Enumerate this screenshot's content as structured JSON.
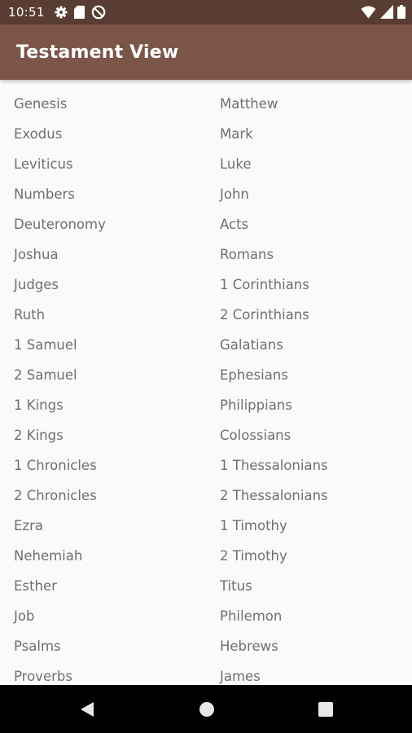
{
  "status_bar": {
    "time": "10:51",
    "left_icons": [
      "gear-icon",
      "sd-card-icon",
      "do-not-disturb-icon"
    ],
    "right_icons": [
      "wifi-icon",
      "signal-icon",
      "battery-icon"
    ]
  },
  "app_bar": {
    "title": "Testament View"
  },
  "old_testament": [
    "Genesis",
    "Exodus",
    "Leviticus",
    "Numbers",
    "Deuteronomy",
    "Joshua",
    "Judges",
    "Ruth",
    "1 Samuel",
    "2 Samuel",
    "1 Kings",
    "2 Kings",
    "1 Chronicles",
    "2 Chronicles",
    "Ezra",
    "Nehemiah",
    "Esther",
    "Job",
    "Psalms",
    "Proverbs"
  ],
  "new_testament": [
    "Matthew",
    "Mark",
    "Luke",
    "John",
    "Acts",
    "Romans",
    "1 Corinthians",
    "2 Corinthians",
    "Galatians",
    "Ephesians",
    "Philippians",
    "Colossians",
    "1 Thessalonians",
    "2 Thessalonians",
    "1 Timothy",
    "2 Timothy",
    "Titus",
    "Philemon",
    "Hebrews",
    "James"
  ],
  "nav_bar": {
    "buttons": [
      "back-icon",
      "home-icon",
      "recent-apps-icon"
    ]
  },
  "colors": {
    "status_bar": "#5a3d32",
    "app_bar": "#7a5548",
    "background": "#fafafa",
    "book_text": "#6f6f6f"
  }
}
